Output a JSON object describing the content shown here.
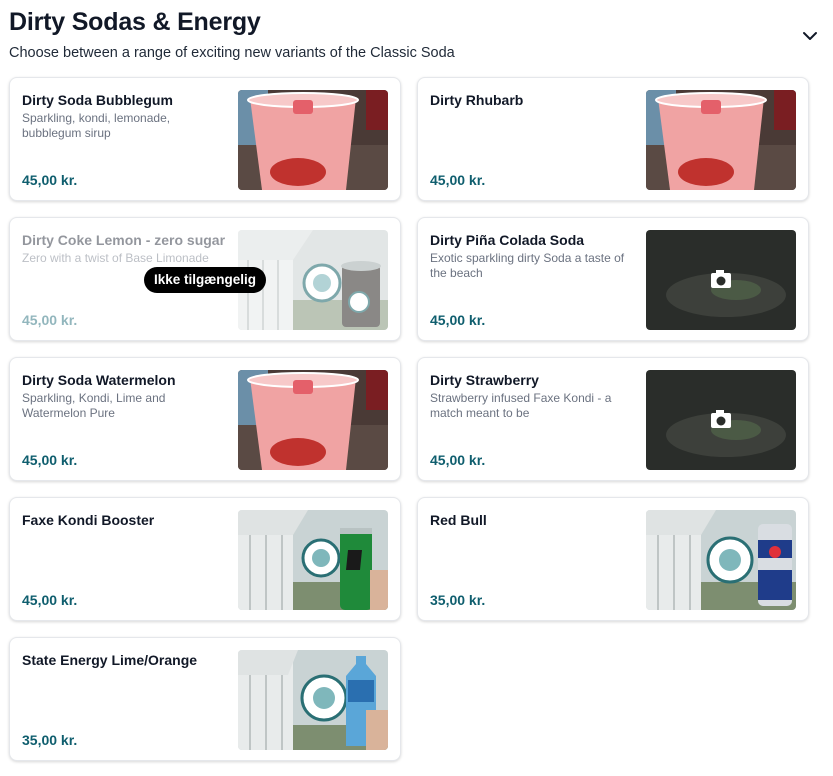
{
  "section": {
    "title": "Dirty Sodas & Energy",
    "subtitle": "Choose between a range of exciting new variants of the Classic Soda"
  },
  "products": [
    {
      "name": "Dirty Soda Bubblegum",
      "description": "Sparkling, kondi, lemonade, bubblegum sirup",
      "price": "45,00 kr.",
      "image": "pink-soda-cup"
    },
    {
      "name": "Dirty Rhubarb",
      "description": "",
      "price": "45,00 kr.",
      "image": "pink-soda-cup"
    },
    {
      "name": "Dirty Coke Lemon - zero sugar",
      "description": "Zero with a twist of Base Limonade",
      "price": "45,00 kr.",
      "image": "cola-cup-logo",
      "badge": "Ikke tilgængelig"
    },
    {
      "name": "Dirty Piña Colada Soda",
      "description": "Exotic sparkling dirty Soda a taste of the beach",
      "price": "45,00 kr.",
      "image": "placeholder-camera"
    },
    {
      "name": "Dirty Soda Watermelon",
      "description": "Sparkling, Kondi, Lime and Watermelon Pure",
      "price": "45,00 kr.",
      "image": "pink-soda-cup"
    },
    {
      "name": "Dirty Strawberry",
      "description": "Strawberry infused Faxe Kondi - a match meant to be",
      "price": "45,00 kr.",
      "image": "placeholder-camera"
    },
    {
      "name": "Faxe Kondi Booster",
      "description": "",
      "price": "45,00 kr.",
      "image": "green-can-logo"
    },
    {
      "name": "Red Bull",
      "description": "",
      "price": "35,00 kr.",
      "image": "redbull-can-logo"
    },
    {
      "name": "State Energy Lime/Orange",
      "description": "",
      "price": "35,00 kr.",
      "image": "blue-bottle-logo"
    }
  ],
  "colors": {
    "price": "#0f5e6e",
    "badge_bg": "#000000"
  }
}
